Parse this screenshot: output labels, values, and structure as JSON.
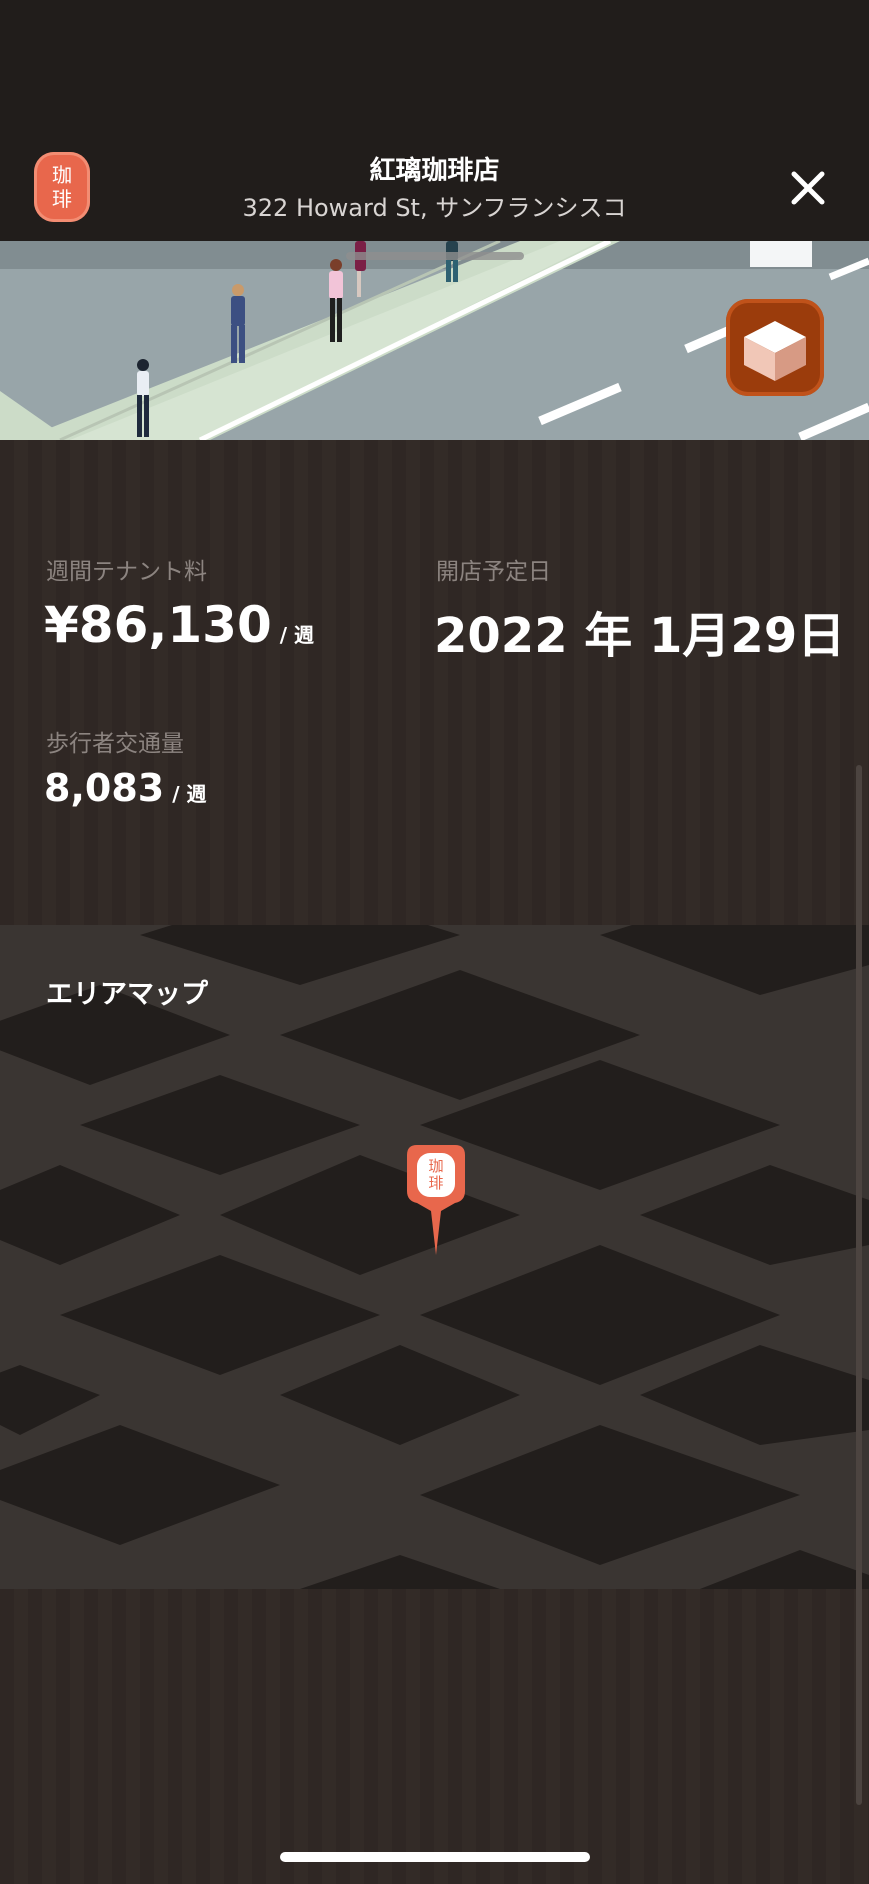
{
  "header": {
    "app_icon_text": [
      "珈",
      "琲"
    ],
    "store_name": "紅璃珈琲店",
    "address": "322 Howard St, サンフランシスコ"
  },
  "stats": {
    "rent_label": "週間テナント料",
    "rent_value": "¥86,130",
    "rent_unit": "/ 週",
    "opening_label": "開店予定日",
    "opening_value": "2022 年 1月29日",
    "traffic_label": "歩行者交通量",
    "traffic_value": "8,083",
    "traffic_unit": "/ 週"
  },
  "map": {
    "title": "エリアマップ",
    "pin_text": [
      "珈",
      "琲"
    ]
  },
  "colors": {
    "accent": "#e8674c",
    "background": "#2f2724",
    "view_3d_button": "#9b3c0c"
  },
  "icons": {
    "close": "close-icon",
    "view_3d": "cube-icon",
    "map_pin": "map-pin-icon"
  }
}
